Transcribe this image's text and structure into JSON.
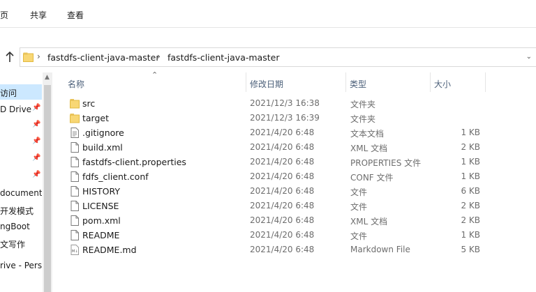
{
  "ribbon": {
    "tabs": [
      "页",
      "共享",
      "查看"
    ]
  },
  "address_bar": {
    "crumbs": [
      "fastdfs-client-java-master",
      "fastdfs-client-java-master"
    ],
    "separator": "›",
    "up_icon": "up-arrow-icon",
    "dropdown_icon": "chevron-down-icon"
  },
  "nav_pane": {
    "items": [
      {
        "label": "访问",
        "selected": true,
        "pinned": false
      },
      {
        "label": "D Drive",
        "selected": false,
        "pinned": true
      },
      {
        "label": "",
        "selected": false,
        "pinned": true
      },
      {
        "label": "",
        "selected": false,
        "pinned": true
      },
      {
        "label": "",
        "selected": false,
        "pinned": true
      },
      {
        "label": "",
        "selected": false,
        "pinned": true
      },
      {
        "label": "document",
        "selected": false,
        "pinned": false
      },
      {
        "label": "开发模式",
        "selected": false,
        "pinned": false
      },
      {
        "label": "ngBoot",
        "selected": false,
        "pinned": false
      },
      {
        "label": "文写作",
        "selected": false,
        "pinned": false
      },
      {
        "label": "rive - Perso",
        "selected": false,
        "pinned": false
      }
    ]
  },
  "columns": {
    "name": "名称",
    "date": "修改日期",
    "type": "类型",
    "size": "大小"
  },
  "files": [
    {
      "name": "src",
      "date": "2021/12/3 16:38",
      "type": "文件夹",
      "size": "",
      "icon": "folder-icon"
    },
    {
      "name": "target",
      "date": "2021/12/3 16:39",
      "type": "文件夹",
      "size": "",
      "icon": "folder-icon"
    },
    {
      "name": ".gitignore",
      "date": "2021/4/20 6:48",
      "type": "文本文档",
      "size": "1 KB",
      "icon": "text-file-icon"
    },
    {
      "name": "build.xml",
      "date": "2021/4/20 6:48",
      "type": "XML 文档",
      "size": "2 KB",
      "icon": "file-icon"
    },
    {
      "name": "fastdfs-client.properties",
      "date": "2021/4/20 6:48",
      "type": "PROPERTIES 文件",
      "size": "1 KB",
      "icon": "file-icon"
    },
    {
      "name": "fdfs_client.conf",
      "date": "2021/4/20 6:48",
      "type": "CONF 文件",
      "size": "1 KB",
      "icon": "file-icon"
    },
    {
      "name": "HISTORY",
      "date": "2021/4/20 6:48",
      "type": "文件",
      "size": "6 KB",
      "icon": "file-icon"
    },
    {
      "name": "LICENSE",
      "date": "2021/4/20 6:48",
      "type": "文件",
      "size": "2 KB",
      "icon": "file-icon"
    },
    {
      "name": "pom.xml",
      "date": "2021/4/20 6:48",
      "type": "XML 文档",
      "size": "2 KB",
      "icon": "file-icon"
    },
    {
      "name": "README",
      "date": "2021/4/20 6:48",
      "type": "文件",
      "size": "1 KB",
      "icon": "file-icon"
    },
    {
      "name": "README.md",
      "date": "2021/4/20 6:48",
      "type": "Markdown File",
      "size": "5 KB",
      "icon": "markdown-file-icon"
    }
  ],
  "colors": {
    "selection": "#cce8ff",
    "header_text": "#4c607a",
    "folder_yellow": "#f8d775"
  }
}
